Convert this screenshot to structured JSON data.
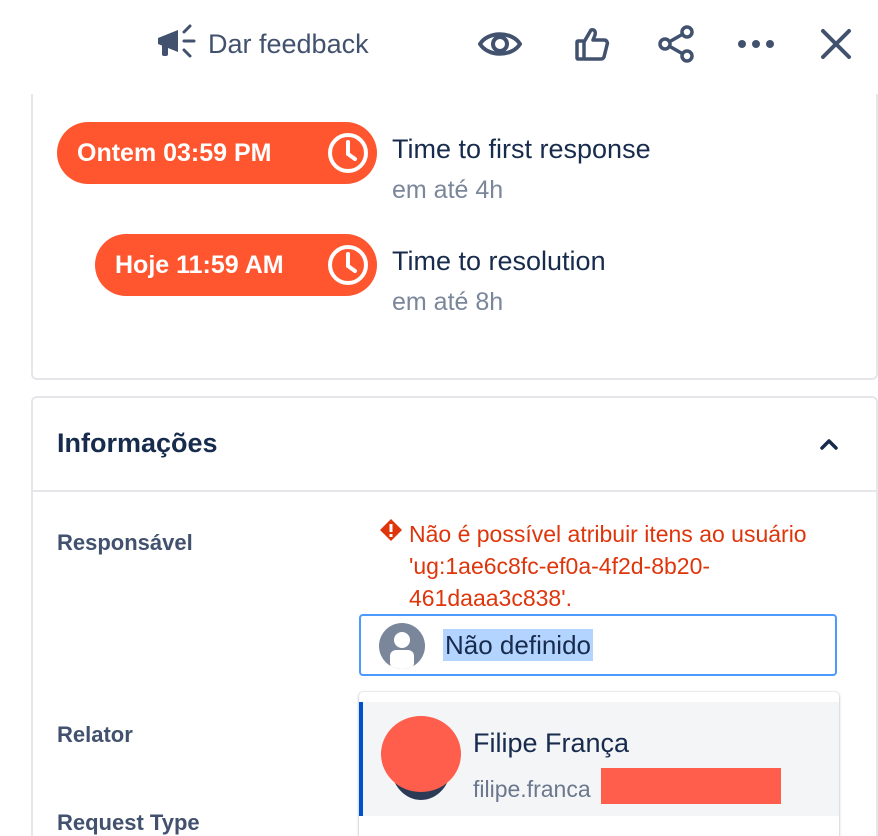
{
  "toolbar": {
    "feedback_label": "Dar feedback",
    "icons": [
      "megaphone-icon",
      "eye-icon",
      "thumbs-up-icon",
      "share-icon",
      "more-icon",
      "close-icon"
    ]
  },
  "sla": {
    "items": [
      {
        "time": "Ontem 03:59 PM",
        "title": "Time to first response",
        "subtitle": "em até 4h"
      },
      {
        "time": "Hoje 11:59 AM",
        "title": "Time to resolution",
        "subtitle": "em até 8h"
      }
    ],
    "pill_color": "#ff5630"
  },
  "info": {
    "title": "Informações",
    "fields": {
      "assignee_label": "Responsável",
      "reporter_label": "Relator",
      "request_type_label": "Request Type"
    },
    "error": {
      "line1": "Não é possível atribuir itens ao usuário",
      "line2": "'ug:1ae6c8fc-ef0a-4f2d-8b20-",
      "line3": "461daaa3c838'.",
      "color": "#de350b"
    },
    "assignee_value": "Não definido",
    "dropdown": {
      "option_name": "Filipe França",
      "option_email": "filipe.franca"
    }
  }
}
